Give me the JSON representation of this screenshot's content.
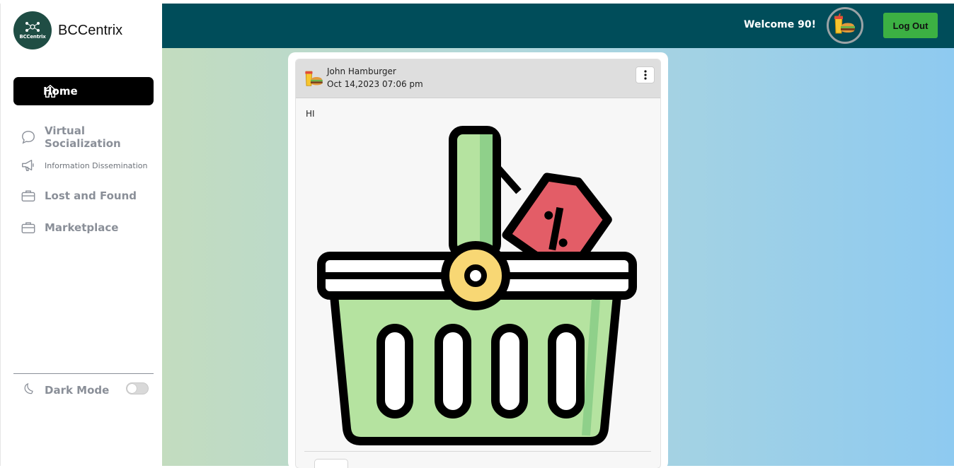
{
  "brand": {
    "name": "BCCentrix",
    "logo_text": "BCCentrix"
  },
  "sidebar": {
    "items": [
      {
        "label": "Home",
        "icon": "home-icon",
        "active": true
      },
      {
        "label": "Virtual Socialization",
        "icon": "chat-bubble-icon"
      },
      {
        "label": "Information Dissemination",
        "icon": "megaphone-icon"
      },
      {
        "label": "Lost and Found",
        "icon": "briefcase-icon"
      },
      {
        "label": "Marketplace",
        "icon": "briefcase-icon"
      }
    ],
    "dark_mode_label": "Dark Mode",
    "dark_mode_on": false
  },
  "header": {
    "welcome": "Welcome 90!",
    "logout_label": "Log Out",
    "accent": "#004d5a",
    "logout_color": "#3cb043"
  },
  "post": {
    "author": "John Hamburger",
    "date": "Oct 14,2023 07:06 pm",
    "text": "HI",
    "image": "shopping-basket-with-discount-tag",
    "menu_icon": "kebab-menu-icon"
  }
}
